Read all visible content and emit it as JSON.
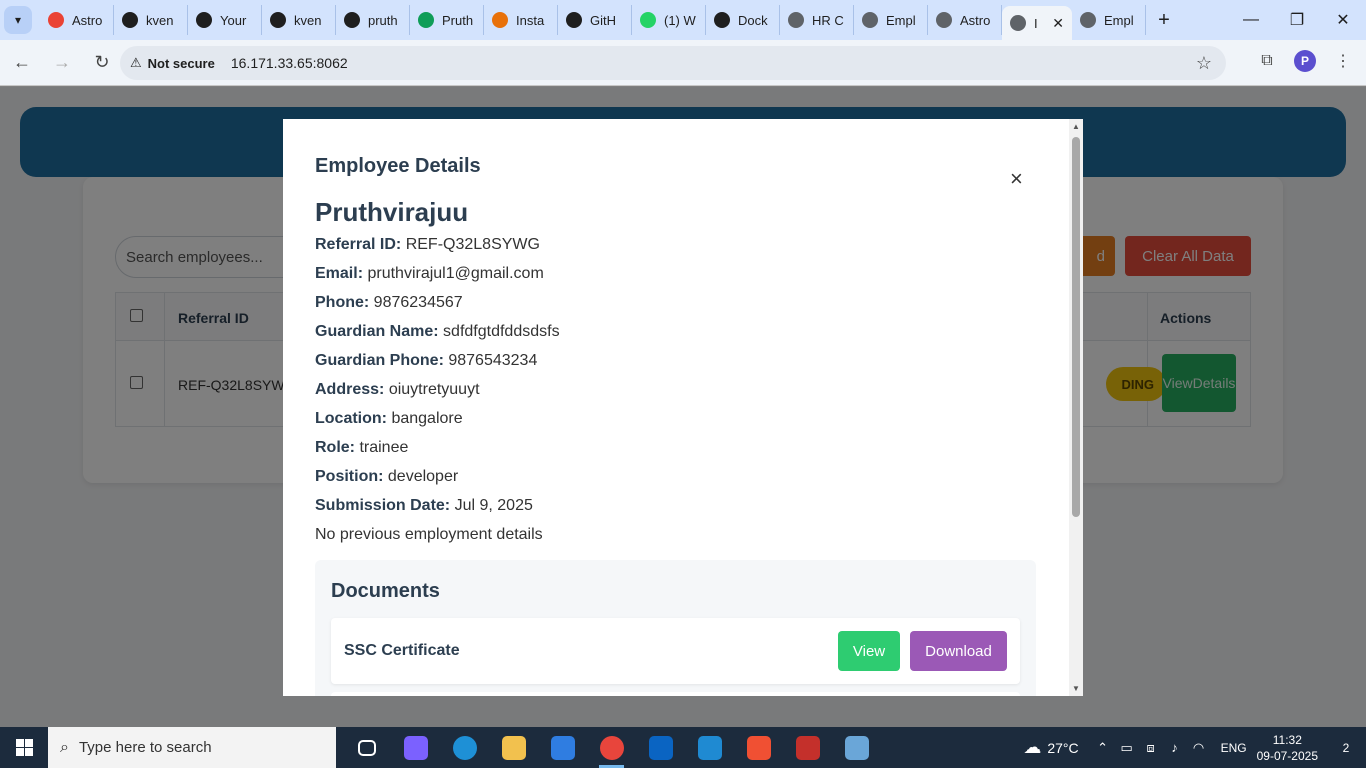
{
  "browser": {
    "tabs": [
      {
        "label": "Astro",
        "icon": "gmail-icon",
        "color": "#ea4335"
      },
      {
        "label": "kven",
        "icon": "github-icon",
        "color": "#1f1f1f"
      },
      {
        "label": "Your",
        "icon": "github-icon",
        "color": "#1f1f1f"
      },
      {
        "label": "kven",
        "icon": "github-icon",
        "color": "#1f1f1f"
      },
      {
        "label": "pruth",
        "icon": "github-icon",
        "color": "#1f1f1f"
      },
      {
        "label": "Pruth",
        "icon": "sheets-icon",
        "color": "#0f9d58"
      },
      {
        "label": "Insta",
        "icon": "instance-icon",
        "color": "#e8710a"
      },
      {
        "label": "GitH",
        "icon": "github-icon",
        "color": "#1f1f1f"
      },
      {
        "label": "(1) W",
        "icon": "whatsapp-icon",
        "color": "#25d366"
      },
      {
        "label": "Dock",
        "icon": "chatgpt-icon",
        "color": "#1f1f1f"
      },
      {
        "label": "HR C",
        "icon": "globe-icon",
        "color": "#5f6368"
      },
      {
        "label": "Empl",
        "icon": "globe-icon",
        "color": "#5f6368"
      },
      {
        "label": "Astro",
        "icon": "globe-icon",
        "color": "#5f6368"
      },
      {
        "label": "I",
        "icon": "globe-icon",
        "color": "#5f6368",
        "active": true
      },
      {
        "label": "Empl",
        "icon": "globe-icon",
        "color": "#5f6368"
      }
    ],
    "security_label": "Not secure",
    "url": "16.171.33.65:8062",
    "profile_initial": "P"
  },
  "page": {
    "search_placeholder": "Search employees...",
    "amber_button_label": "d",
    "clear_button_label": "Clear All Data",
    "table": {
      "headers": [
        "Referral ID",
        "Actions"
      ],
      "rows": [
        {
          "referral_id": "REF-Q32L8SYWG",
          "status": "DING",
          "action_label_1": "View",
          "action_label_2": "Details"
        }
      ]
    }
  },
  "modal": {
    "title": "Employee Details",
    "close_glyph": "×",
    "employee_name": "Pruthvirajuu",
    "details": [
      {
        "label": "Referral ID:",
        "value": "REF-Q32L8SYWG"
      },
      {
        "label": "Email:",
        "value": "pruthvirajul1@gmail.com"
      },
      {
        "label": "Phone:",
        "value": "9876234567"
      },
      {
        "label": "Guardian Name:",
        "value": "sdfdfgtdfddsdsfs"
      },
      {
        "label": "Guardian Phone:",
        "value": "9876543234"
      },
      {
        "label": "Address:",
        "value": "oiuytretyuuyt"
      },
      {
        "label": "Location:",
        "value": "bangalore"
      },
      {
        "label": "Role:",
        "value": "trainee"
      },
      {
        "label": "Position:",
        "value": "developer"
      },
      {
        "label": "Submission Date:",
        "value": "Jul 9, 2025"
      }
    ],
    "employment_note": "No previous employment details",
    "documents": {
      "title": "Documents",
      "items": [
        {
          "name": "SSC Certificate",
          "view_label": "View",
          "download_label": "Download"
        }
      ]
    }
  },
  "taskbar": {
    "search_placeholder": "Type here to search",
    "temperature": "27°C",
    "language": "ENG",
    "time": "11:32",
    "date": "09-07-2025",
    "notification_count": "2",
    "apps": [
      {
        "name": "task-view-icon",
        "color": "#1c2b3d"
      },
      {
        "name": "copilot-icon",
        "color": "#7b61ff"
      },
      {
        "name": "edge-icon",
        "color": "#1e90d6"
      },
      {
        "name": "file-explorer-icon",
        "color": "#f2c14e"
      },
      {
        "name": "store-icon",
        "color": "#2f7de1"
      },
      {
        "name": "chrome-icon",
        "color": "#e8453c",
        "active": true
      },
      {
        "name": "outlook-icon",
        "color": "#0a64c2"
      },
      {
        "name": "vscode-icon",
        "color": "#1f8ad2"
      },
      {
        "name": "git-icon",
        "color": "#f05033"
      },
      {
        "name": "postman-icon",
        "color": "#c4302b"
      },
      {
        "name": "notepad-icon",
        "color": "#6aa6d8"
      }
    ]
  }
}
